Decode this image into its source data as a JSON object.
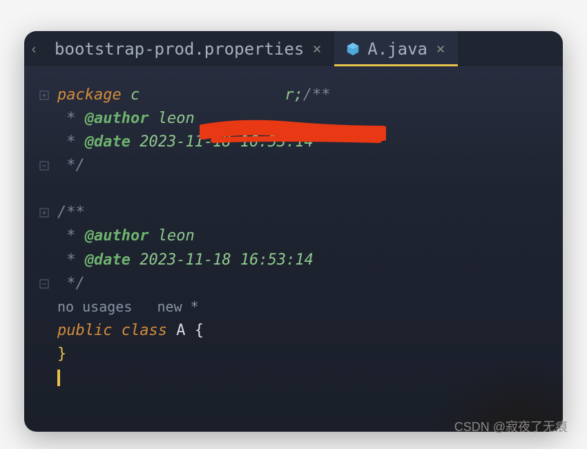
{
  "tabs": [
    {
      "label": "bootstrap-prod.properties",
      "active": false
    },
    {
      "label": "A.java",
      "active": true
    }
  ],
  "code": {
    "package_kw": "package",
    "package_pre": " c",
    "package_post": "r",
    "semicolon": ";",
    "doc_open": "/**",
    "doc_star": " *",
    "author_tag": " @author",
    "author_val": " leon",
    "date_tag": " @date",
    "date_val": " 2023-11-18 16:53:14",
    "doc_close": " */",
    "hints": {
      "no_usages": "no usages",
      "new_marker": "new *"
    },
    "public_kw": "public ",
    "class_kw": "class ",
    "class_name": "A ",
    "open_brace": "{",
    "close_brace": "}"
  },
  "watermark": "CSDN @寂夜了无痕"
}
